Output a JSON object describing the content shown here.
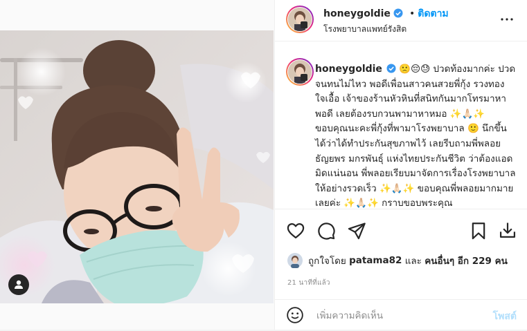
{
  "header": {
    "username": "honeygoldie",
    "separator": "•",
    "follow_label": "ติดตาม",
    "location": "โรงพยาบาลแพทย์รังสิต"
  },
  "caption": {
    "username": "honeygoldie",
    "text": "🙁😔😓 ปวดท้องมากค่ะ ปวดจนทนไม่ไหว พอดีเพื่อนสาวคนสวยพี่กุ้ง รวงทอง ใจเอื้อ เจ้าของร้านหัวหินที่สนิทกันมากโทรมาหาพอดี เลยต้องรบกวนพามาหาหมอ ✨🙏🏻✨ ขอบคุณนะคะพี่กุ้งที่พามาโรงพยาบาล 🙂 นึกขึ้นได้ว่าได้ทำประกันสุขภาพไว้ เลยรีบถามพี่พลอย ธัญยพร มกรพันธุ์ แห่งไทยประกันชีวิต ว่าต้องแอดมิดแน่นอน พี่พลอยเรียบมาจัดการเรื่องโรงพยาบาลให้อย่างรวดเร็ว ✨🙏🏻✨ ขอบคุณพี่พลอยมากมายเลยค่ะ ✨🙏🏻✨ กราบขอบพระคุณ"
  },
  "actions": {
    "like": "heart-icon",
    "comment": "comment-icon",
    "share": "share-icon",
    "save": "bookmark-icon",
    "download": "download-icon"
  },
  "likes": {
    "prefix": "ถูกใจโดย",
    "liker": "patama82",
    "conjunction": "และ",
    "others": "คนอื่นๆ อีก 229 คน"
  },
  "timestamp": "21 นาทีที่แล้ว",
  "add_comment": {
    "placeholder": "เพิ่มความคิดเห็น",
    "post_label": "โพสต์"
  },
  "colors": {
    "accent": "#0095f6",
    "verified": "#3897f0",
    "post_disabled": "#b2dffc"
  }
}
